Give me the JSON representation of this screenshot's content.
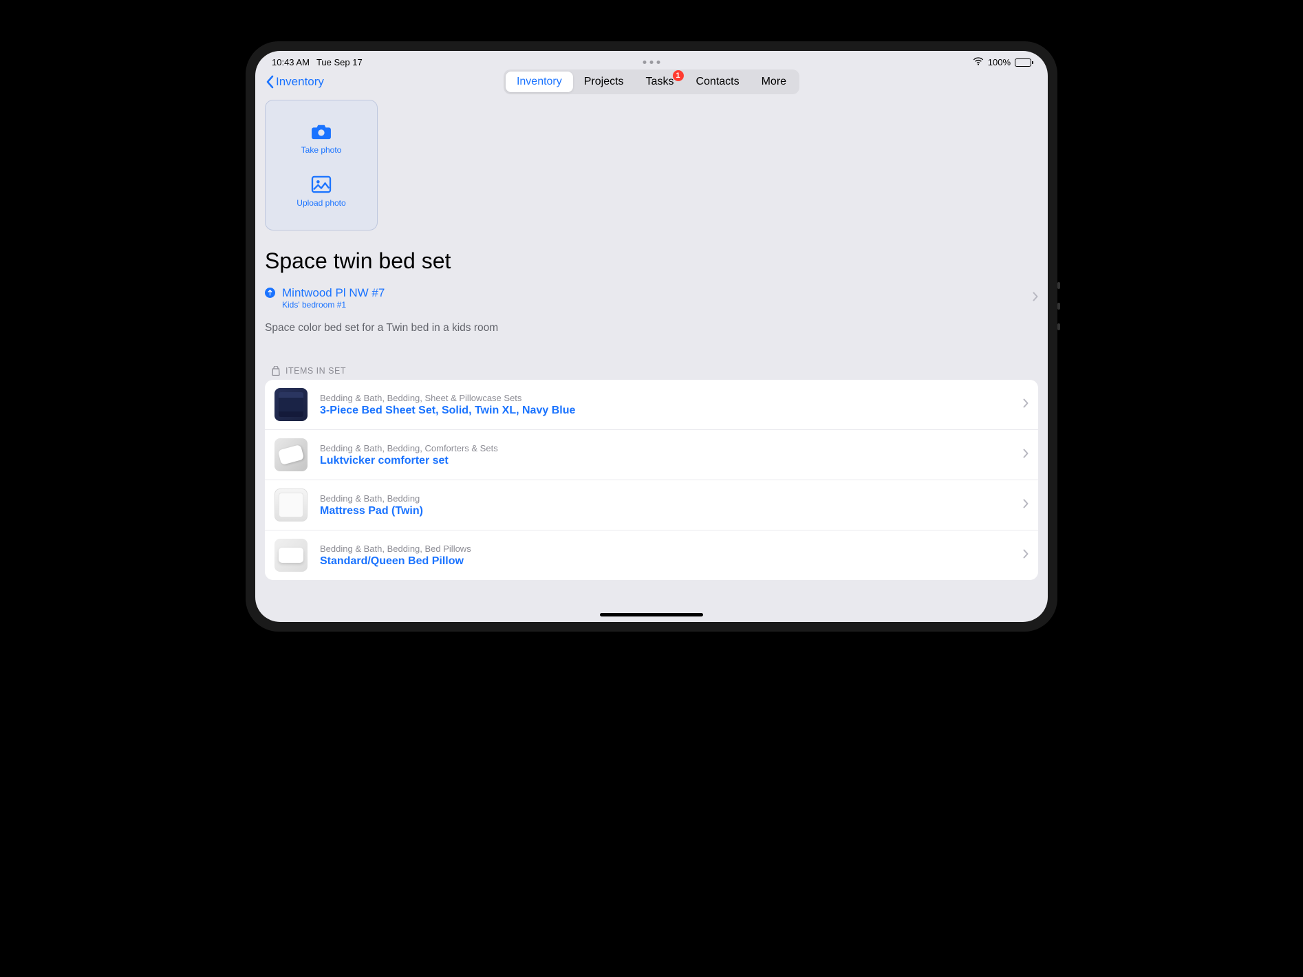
{
  "status": {
    "time": "10:43 AM",
    "date": "Tue Sep 17",
    "battery_text": "100%"
  },
  "nav": {
    "back_label": "Inventory",
    "tabs": {
      "inventory": "Inventory",
      "projects": "Projects",
      "tasks": "Tasks",
      "tasks_badge": "1",
      "contacts": "Contacts",
      "more": "More"
    }
  },
  "photo": {
    "take": "Take photo",
    "upload": "Upload photo"
  },
  "item": {
    "title": "Space twin bed set",
    "location_primary": "Mintwood Pl NW #7",
    "location_secondary": "Kids' bedroom #1",
    "description": "Space color bed set for a Twin bed in a kids room"
  },
  "section_header": "ITEMS IN SET",
  "items": [
    {
      "category": "Bedding & Bath, Bedding, Sheet & Pillowcase Sets",
      "title": "3-Piece Bed Sheet Set, Solid, Twin XL, Navy Blue"
    },
    {
      "category": "Bedding & Bath, Bedding, Comforters & Sets",
      "title": "Luktvicker comforter set"
    },
    {
      "category": "Bedding & Bath, Bedding",
      "title": "Mattress Pad (Twin)"
    },
    {
      "category": "Bedding & Bath, Bedding, Bed Pillows",
      "title": "Standard/Queen Bed Pillow"
    }
  ]
}
